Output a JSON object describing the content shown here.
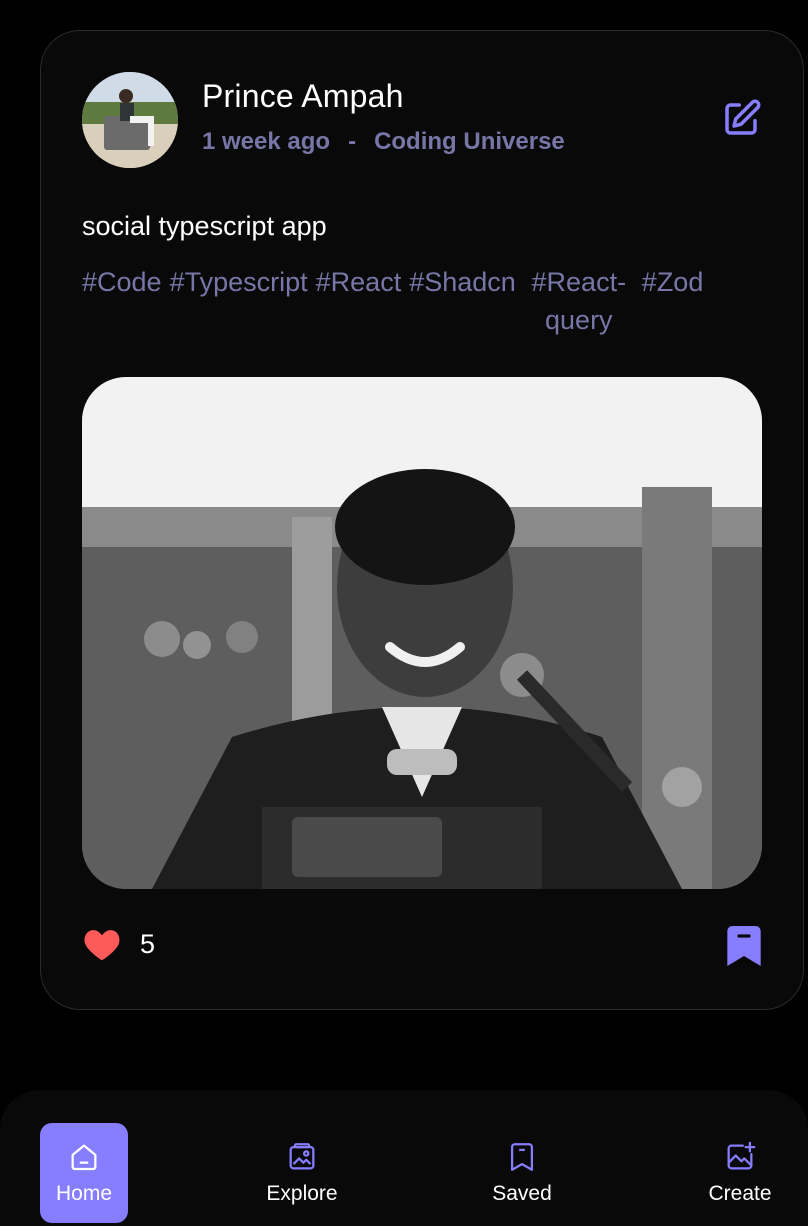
{
  "post": {
    "author_name": "Prince Ampah",
    "time_ago": "1 week ago",
    "separator": "-",
    "location": "Coding Universe",
    "caption": "social typescript app",
    "tags": [
      "#Code",
      "#Typescript",
      "#React",
      "#Shadcn",
      "#React-query",
      "#Zod"
    ],
    "likes_count": "5",
    "icons": {
      "edit": "edit-icon",
      "like": "heart-icon",
      "save": "bookmark-icon"
    }
  },
  "nav": {
    "items": [
      {
        "label": "Home",
        "icon": "home-icon",
        "active": true
      },
      {
        "label": "Explore",
        "icon": "explore-icon",
        "active": false
      },
      {
        "label": "Saved",
        "icon": "bookmark-icon",
        "active": false
      },
      {
        "label": "Create",
        "icon": "create-icon",
        "active": false
      }
    ]
  },
  "colors": {
    "background": "#000000",
    "card": "#09090a",
    "accent": "#877eff",
    "muted_text": "#7876a6",
    "like": "#ff5a5a"
  }
}
